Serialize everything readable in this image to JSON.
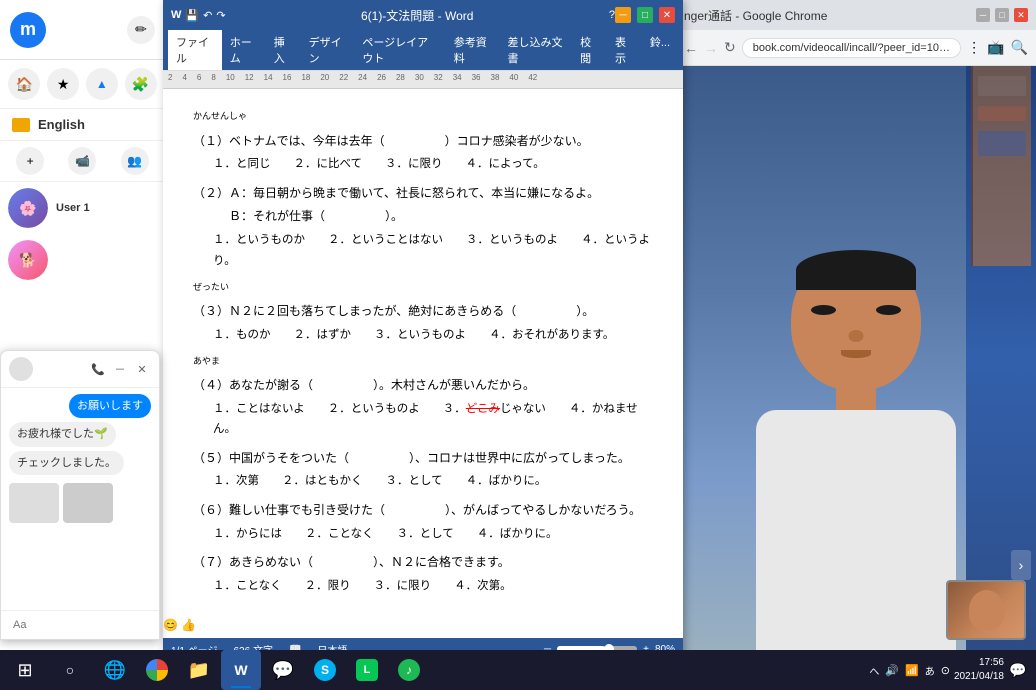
{
  "window": {
    "title": "6(1)-文法問題 - Word",
    "status": {
      "page": "1/1 ページ",
      "words": "626 文字",
      "lang": "日本語",
      "zoom": "80%"
    }
  },
  "ribbon": {
    "tabs": [
      "ファイル",
      "ホーム",
      "挿入",
      "デザイン",
      "ページレイアウト",
      "参考資料",
      "差し込み文書",
      "校閲",
      "表示",
      "鈴..."
    ]
  },
  "document": {
    "questions": [
      {
        "id": 1,
        "text": "（１）ベトナムでは、今年は去年（　　　　　）コロナ感染者が少ない。",
        "furigana": "かんせんしゃ",
        "choices": [
          "１．と同じ",
          "２．に比べて",
          "３．に限り",
          "４．によって。"
        ]
      },
      {
        "id": 2,
        "textA": "（２）Ａ：毎日朝から晩まで働いて、社長に怒られて、本当に嫌になるよ。",
        "textB": "　　　Ｂ：それが仕事（　　　　　）。",
        "choices": [
          "１．というものか",
          "２．ということはない",
          "３．というものよ",
          "４．というより。"
        ]
      },
      {
        "id": 3,
        "text": "（３）Ｎ２に２回も落ちてしまったが、絶対にあきらめる（　　　　　）。",
        "furigana": "ぜったい",
        "choices": [
          "１．ものか",
          "２．はずか",
          "３．というものよ",
          "４．おそれがあります。"
        ]
      },
      {
        "id": 4,
        "text": "（４）あなたが謝る（　　　　　）。木村さんが悪いんだから。",
        "furigana": "あやま",
        "choices": [
          "１．ことはないよ",
          "２．というものよ",
          "３．どこみじゃない",
          "４．かねません。"
        ]
      },
      {
        "id": 5,
        "text": "（５）中国がうそをついた（　　　　　）、コロナは世界中に広がってしまった。",
        "choices": [
          "１．次第",
          "２．はともかく",
          "３．として",
          "４．ばかりに。"
        ]
      },
      {
        "id": 6,
        "text": "（６）難しい仕事でも引き受けた（　　　　　）、がんばってやるしかないだろう。",
        "choices": [
          "１．からには",
          "２．ことなく",
          "３．として",
          "４．ばかりに。"
        ]
      },
      {
        "id": 7,
        "text": "（７）あきらめない（　　　　　）、Ｎ２に合格できます。",
        "choices": [
          "１．ことなく",
          "２．限り",
          "３．に限り",
          "４．次第。"
        ]
      }
    ]
  },
  "chrome": {
    "title": "nger通話 - Google Chrome",
    "url": "book.com/videocall/incall/?peer_id=10001005..."
  },
  "messenger": {
    "english_label": "English",
    "chat": {
      "messages": [
        {
          "type": "sent",
          "text": "お願いします"
        },
        {
          "type": "received",
          "text": "お疲れ様でした🌱"
        },
        {
          "type": "received",
          "text": "チェックしました。"
        }
      ],
      "input_placeholder": "Aa"
    }
  },
  "taskbar": {
    "time": "17:56",
    "date": "2021/04/18",
    "apps": [
      {
        "name": "windows-start",
        "icon": "⊞"
      },
      {
        "name": "cortana-search",
        "icon": "⌕"
      },
      {
        "name": "edge-browser",
        "icon": "🌐"
      },
      {
        "name": "chrome-browser",
        "icon": "●"
      },
      {
        "name": "file-explorer",
        "icon": "📁"
      },
      {
        "name": "word-app",
        "icon": "W"
      },
      {
        "name": "messenger-app",
        "icon": "💬"
      },
      {
        "name": "skype-app",
        "icon": "S"
      },
      {
        "name": "line-app",
        "icon": "L"
      },
      {
        "name": "spotify-app",
        "icon": "♪"
      }
    ],
    "sys": [
      "へ",
      "∧",
      "小",
      "雷",
      "あ",
      "⊙"
    ]
  }
}
